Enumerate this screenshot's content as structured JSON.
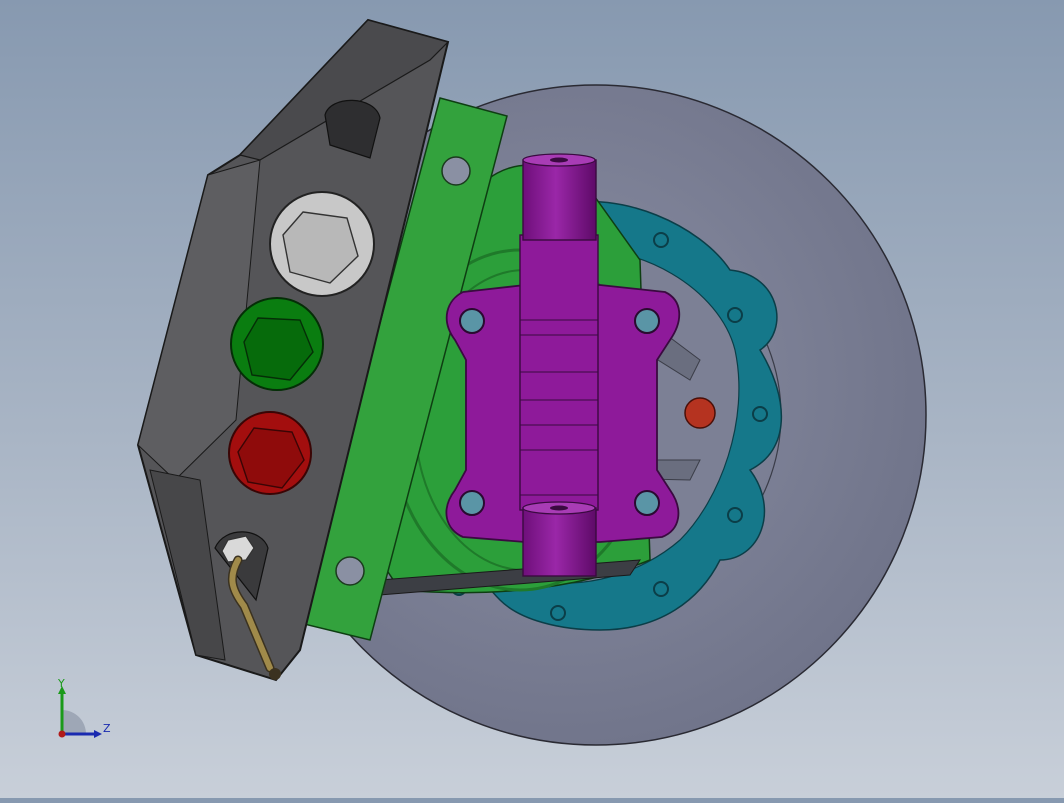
{
  "viewport": {
    "colors": {
      "background_top": "#8799b0",
      "background_bottom": "#c8cfd9",
      "disc": "#7c8095",
      "caliper": "#555558",
      "bracket_plate": "#33a23d",
      "hub_shell": "#2c9f3a",
      "mount_flange": "#15788a",
      "knuckle": "#8e1a9a",
      "bolt_silver": "#c8c8c8",
      "bolt_green": "#0a7d10",
      "bolt_red": "#a30e0e",
      "brake_line": "#a08a4a",
      "pin_red": "#b53320"
    },
    "components": [
      {
        "name": "brake-disc",
        "color_key": "disc"
      },
      {
        "name": "caliper-body",
        "color_key": "caliper"
      },
      {
        "name": "mounting-bracket-plate",
        "color_key": "bracket_plate"
      },
      {
        "name": "hub-shell",
        "color_key": "hub_shell"
      },
      {
        "name": "mounting-flange",
        "color_key": "mount_flange"
      },
      {
        "name": "steering-knuckle",
        "color_key": "knuckle"
      },
      {
        "name": "brake-line",
        "color_key": "brake_line"
      }
    ]
  },
  "triad": {
    "y_label": "Y",
    "z_label": "Z",
    "y_color": "#1a9a1a",
    "z_color": "#1a2ab0",
    "x_color": "#b01a1a"
  }
}
